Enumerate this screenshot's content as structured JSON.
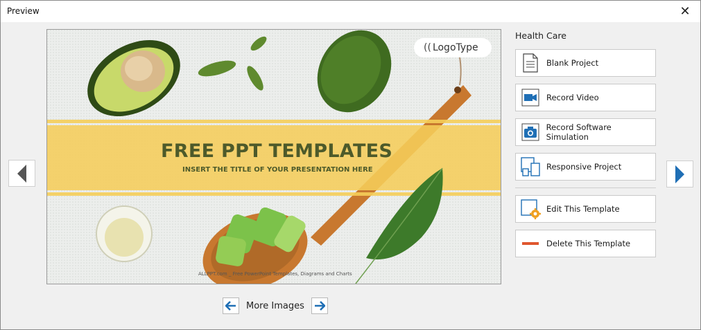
{
  "window": {
    "title": "Preview"
  },
  "slide": {
    "headline": "FREE PPT TEMPLATES",
    "subheadline": "INSERT THE TITLE OF YOUR PRESENTATION HERE",
    "logo_text": "LogoType",
    "footer": "ALLPPT.com _ Free PowerPoint Templates, Diagrams and Charts"
  },
  "gallery": {
    "more_images_label": "More Images"
  },
  "panel": {
    "category": "Health Care",
    "actions": [
      {
        "label": "Blank Project",
        "icon": "blank-page-icon"
      },
      {
        "label": "Record Video",
        "icon": "video-camera-icon"
      },
      {
        "label": "Record Software Simulation",
        "icon": "camera-icon"
      },
      {
        "label": "Responsive Project",
        "icon": "devices-icon"
      },
      {
        "label": "Edit This Template",
        "icon": "edit-template-icon"
      },
      {
        "label": "Delete This Template",
        "icon": "delete-icon"
      }
    ]
  },
  "colors": {
    "accent_blue": "#1f6fb5",
    "band_yellow": "#f5cd5a",
    "headline": "#4d5a2a",
    "delete_red": "#e0572f",
    "gear_orange": "#f0a020"
  }
}
